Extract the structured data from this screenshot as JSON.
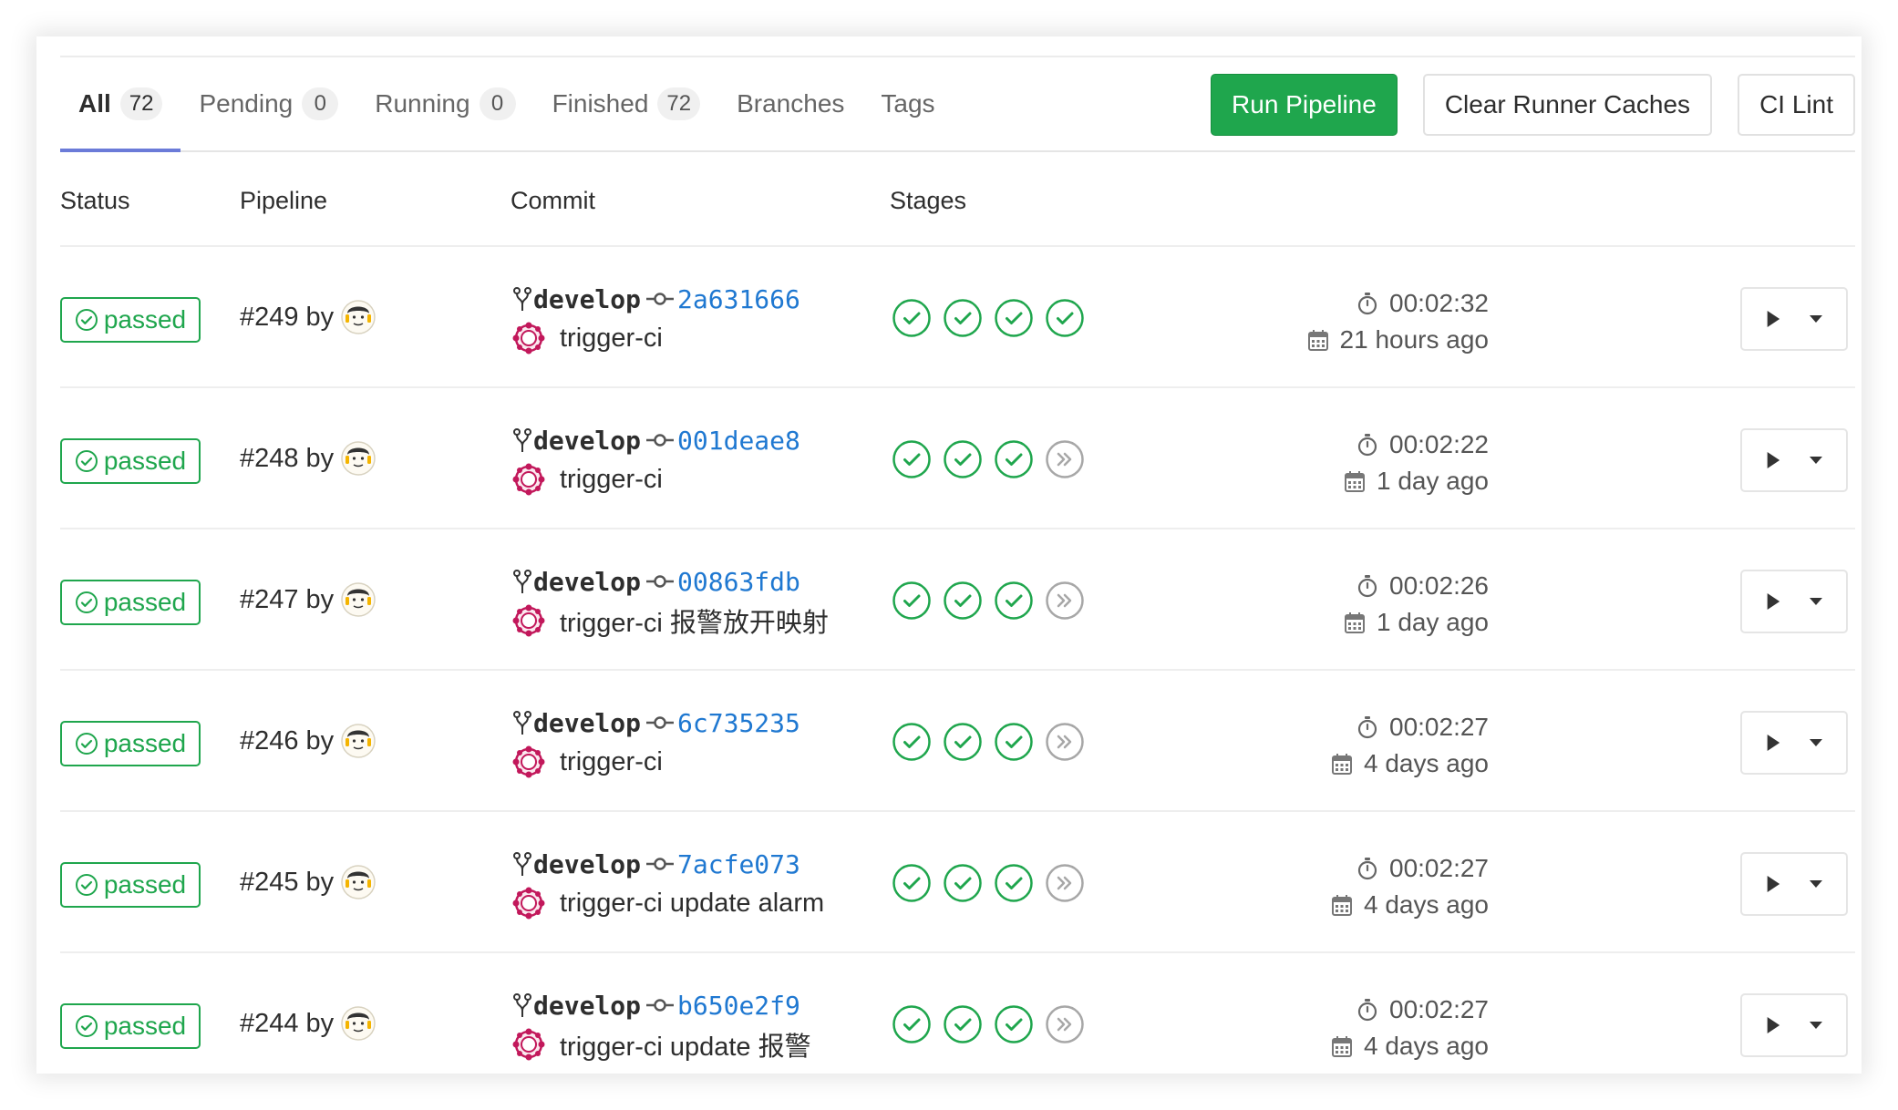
{
  "tabs": [
    {
      "label": "All",
      "count": "72",
      "active": true
    },
    {
      "label": "Pending",
      "count": "0"
    },
    {
      "label": "Running",
      "count": "0"
    },
    {
      "label": "Finished",
      "count": "72"
    },
    {
      "label": "Branches"
    },
    {
      "label": "Tags"
    }
  ],
  "actions": {
    "run_pipeline": "Run Pipeline",
    "clear_caches": "Clear Runner Caches",
    "ci_lint": "CI Lint"
  },
  "table": {
    "headers": {
      "status": "Status",
      "pipeline": "Pipeline",
      "commit": "Commit",
      "stages": "Stages"
    }
  },
  "icons": {
    "status": "check-circle-icon",
    "branch": "branch-icon",
    "commit": "commit-icon",
    "stage_success": "check-circle-icon",
    "stage_skipped": "skipped-icon",
    "duration": "timer-icon",
    "finished": "calendar-icon",
    "play": "play-icon",
    "dropdown": "caret-down-icon"
  },
  "colors": {
    "success": "#1fa64d",
    "link": "#1f78d1",
    "tab_underline": "#6b7bd8",
    "skipped": "#a7a7a7"
  },
  "pipelines": [
    {
      "status": "passed",
      "id": "#249",
      "by": "by",
      "ref": "develop",
      "sha": "2a631666",
      "message": "trigger-ci",
      "stages": [
        "success",
        "success",
        "success",
        "success"
      ],
      "duration": "00:02:32",
      "finished": "21 hours ago"
    },
    {
      "status": "passed",
      "id": "#248",
      "by": "by",
      "ref": "develop",
      "sha": "001deae8",
      "message": "trigger-ci",
      "stages": [
        "success",
        "success",
        "success",
        "skipped"
      ],
      "duration": "00:02:22",
      "finished": "1 day ago"
    },
    {
      "status": "passed",
      "id": "#247",
      "by": "by",
      "ref": "develop",
      "sha": "00863fdb",
      "message": "trigger-ci 报警放开映射",
      "stages": [
        "success",
        "success",
        "success",
        "skipped"
      ],
      "duration": "00:02:26",
      "finished": "1 day ago"
    },
    {
      "status": "passed",
      "id": "#246",
      "by": "by",
      "ref": "develop",
      "sha": "6c735235",
      "message": "trigger-ci",
      "stages": [
        "success",
        "success",
        "success",
        "skipped"
      ],
      "duration": "00:02:27",
      "finished": "4 days ago"
    },
    {
      "status": "passed",
      "id": "#245",
      "by": "by",
      "ref": "develop",
      "sha": "7acfe073",
      "message": "trigger-ci update alarm",
      "stages": [
        "success",
        "success",
        "success",
        "skipped"
      ],
      "duration": "00:02:27",
      "finished": "4 days ago"
    },
    {
      "status": "passed",
      "id": "#244",
      "by": "by",
      "ref": "develop",
      "sha": "b650e2f9",
      "message": "trigger-ci update 报警",
      "stages": [
        "success",
        "success",
        "success",
        "skipped"
      ],
      "duration": "00:02:27",
      "finished": "4 days ago"
    }
  ]
}
